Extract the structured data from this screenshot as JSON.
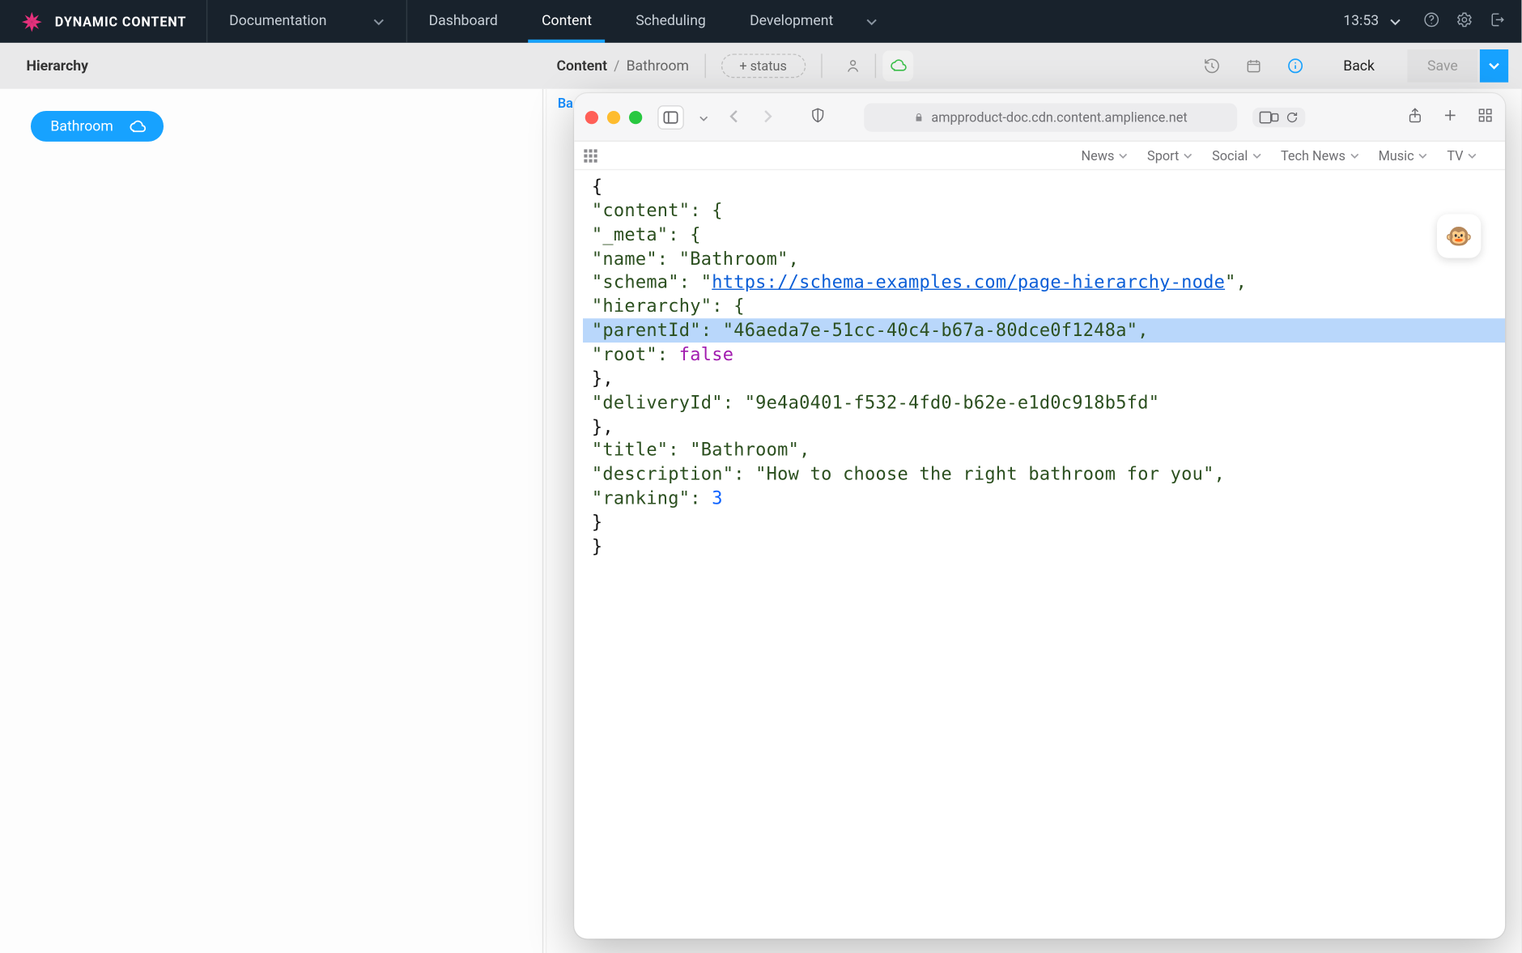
{
  "brand": {
    "title": "DYNAMIC CONTENT"
  },
  "nav": {
    "documentation": "Documentation",
    "tabs": [
      "Dashboard",
      "Content",
      "Scheduling"
    ],
    "active_tab": "Content",
    "development": "Development"
  },
  "topbar": {
    "time": "13:53"
  },
  "toolbar": {
    "title": "Hierarchy",
    "crumb_root": "Content",
    "crumb_sep": "/",
    "crumb_leaf": "Bathroom",
    "add_status": "+ status",
    "back": "Back",
    "save": "Save"
  },
  "sidebar": {
    "node_label": "Bathroom"
  },
  "editor": {
    "behind_label": "Ba"
  },
  "safari": {
    "address": "ampproduct-doc.cdn.content.amplience.net",
    "tabs": [
      "News",
      "Sport",
      "Social",
      "Tech News",
      "Music",
      "TV"
    ],
    "monkey": "🐵"
  },
  "json_content": {
    "content": {
      "_meta": {
        "name": "Bathroom",
        "schema": "https://schema-examples.com/page-hierarchy-node",
        "hierarchy": {
          "parentId": "46aeda7e-51cc-40c4-b67a-80dce0f1248a",
          "root": false
        },
        "deliveryId": "9e4a0401-f532-4fd0-b62e-e1d0c918b5fd"
      },
      "title": "Bathroom",
      "description": "How to choose the right bathroom for you",
      "ranking": 3
    }
  },
  "json_render": {
    "l1": "{",
    "l2_pre": "  \"content\": {",
    "l3": "    \"_meta\": {",
    "l4": "      \"name\": \"Bathroom\",",
    "l5a": "      \"schema\": \"",
    "l5link": "https://schema-examples.com/page-hierarchy-node",
    "l5b": "\",",
    "l6": "      \"hierarchy\": {",
    "l7": "        \"parentId\": \"46aeda7e-51cc-40c4-b67a-80dce0f1248a\",",
    "l8a": "        \"root\": ",
    "l8kw": "false",
    "l9": "      },",
    "l10": "      \"deliveryId\": \"9e4a0401-f532-4fd0-b62e-e1d0c918b5fd\"",
    "l11": "    },",
    "l12": "    \"title\": \"Bathroom\",",
    "l13": "    \"description\": \"How to choose the right bathroom for you\",",
    "l14a": "    \"ranking\": ",
    "l14num": "3",
    "l15": "  }",
    "l16": "}"
  }
}
